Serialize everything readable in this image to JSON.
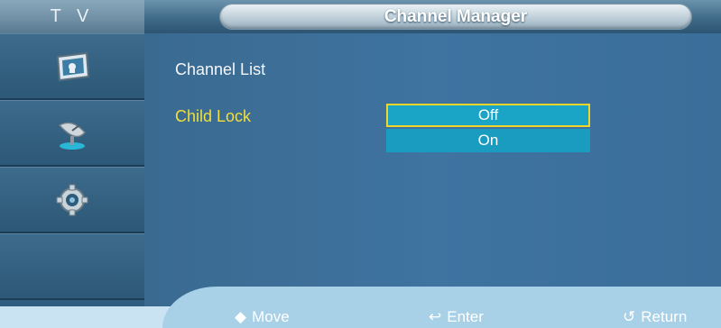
{
  "header": {
    "tv_label": "T V",
    "title": "Channel Manager"
  },
  "sidebar": {
    "items": [
      {
        "icon": "picture-icon"
      },
      {
        "icon": "satellite-dish-icon"
      },
      {
        "icon": "gear-icon"
      },
      {
        "icon": ""
      }
    ]
  },
  "menu": {
    "channel_list": "Channel List",
    "child_lock": "Child Lock",
    "options": [
      "Off",
      "On"
    ],
    "selected": "Off"
  },
  "help": {
    "move": "Move",
    "enter": "Enter",
    "return": "Return"
  },
  "colors": {
    "highlight_text": "#f2df3a",
    "option_bg": "#1aa4c6",
    "focus_border": "#f0d52b"
  }
}
